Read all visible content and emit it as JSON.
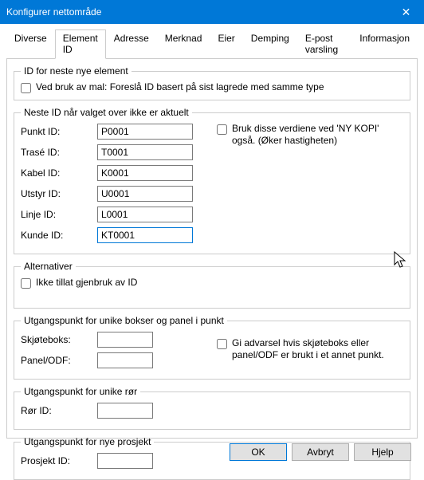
{
  "window": {
    "title": "Konfigurer nettområde",
    "close_glyph": "✕"
  },
  "tabs": [
    {
      "label": "Diverse"
    },
    {
      "label": "Element ID"
    },
    {
      "label": "Adresse"
    },
    {
      "label": "Merknad"
    },
    {
      "label": "Eier"
    },
    {
      "label": "Demping"
    },
    {
      "label": "E-post varsling"
    },
    {
      "label": "Informasjon"
    }
  ],
  "active_tab_index": 1,
  "fs_id_next": {
    "legend": "ID for neste nye element",
    "cb_template_label": "Ved bruk av mal: Foreslå ID basert på sist lagrede med samme type"
  },
  "fs_neste": {
    "legend": "Neste ID når valget over ikke er aktuelt",
    "rows": {
      "punkt": {
        "label": "Punkt ID:",
        "value": "P0001"
      },
      "trase": {
        "label": "Trasé ID:",
        "value": "T0001"
      },
      "kabel": {
        "label": "Kabel ID:",
        "value": "K0001"
      },
      "utstyr": {
        "label": "Utstyr ID:",
        "value": "U0001"
      },
      "linje": {
        "label": "Linje ID:",
        "value": "L0001"
      },
      "kunde": {
        "label": "Kunde ID:",
        "value": "KT0001"
      }
    },
    "cb_nykopi_label": "Bruk disse verdiene ved 'NY KOPI' også. (Øker hastigheten)"
  },
  "fs_alt": {
    "legend": "Alternativer",
    "cb_reuse_label": "Ikke tillat gjenbruk av ID"
  },
  "fs_boks": {
    "legend": "Utgangspunkt for unike bokser og panel i punkt",
    "skjoteboks_label": "Skjøteboks:",
    "panel_label": "Panel/ODF:",
    "skjoteboks_value": "",
    "panel_value": "",
    "cb_warn_label": "Gi advarsel hvis skjøteboks eller panel/ODF er brukt i et annet punkt."
  },
  "fs_ror": {
    "legend": "Utgangspunkt for unike rør",
    "ror_label": "Rør ID:",
    "ror_value": ""
  },
  "fs_prosjekt": {
    "legend": "Utgangspunkt for nye prosjekt",
    "prosjekt_label": "Prosjekt ID:",
    "prosjekt_value": ""
  },
  "buttons": {
    "ok": "OK",
    "cancel": "Avbryt",
    "help": "Hjelp"
  }
}
